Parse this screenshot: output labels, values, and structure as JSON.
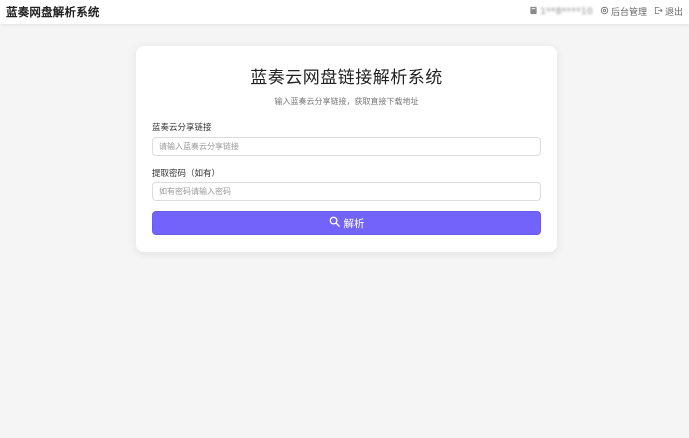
{
  "header": {
    "brand": "蓝奏网盘解析系统",
    "user_masked": "1**8****10",
    "admin_label": "后台管理",
    "logout_label": "退出",
    "icons": [
      "user-icon",
      "gear-icon",
      "logout-icon"
    ]
  },
  "form": {
    "title": "蓝奏云网盘链接解析系统",
    "subtitle": "输入蓝奏云分享链接，获取直接下载地址",
    "link_label": "蓝奏云分享链接",
    "link_placeholder": "请输入蓝奏云分享链接",
    "link_value": "",
    "password_label": "提取密码（如有）",
    "password_placeholder": "如有密码请输入密码",
    "password_value": "",
    "submit_label": "解析",
    "submit_icon": "search-icon"
  },
  "colors": {
    "primary": "#7264fb",
    "background": "#f5f5f5",
    "card": "#ffffff"
  }
}
